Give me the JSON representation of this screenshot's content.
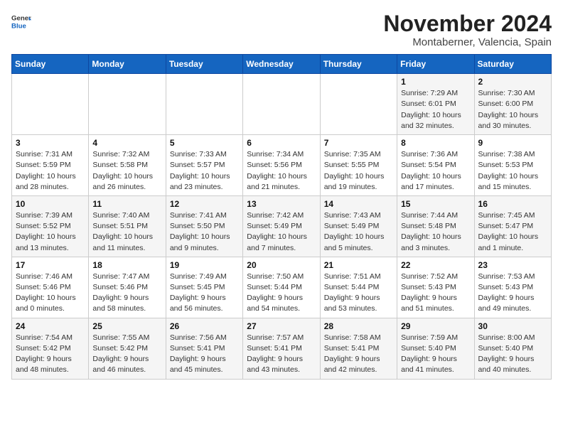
{
  "header": {
    "logo_line1": "General",
    "logo_line2": "Blue",
    "month": "November 2024",
    "location": "Montaberner, Valencia, Spain"
  },
  "weekdays": [
    "Sunday",
    "Monday",
    "Tuesday",
    "Wednesday",
    "Thursday",
    "Friday",
    "Saturday"
  ],
  "weeks": [
    [
      {
        "day": "",
        "info": ""
      },
      {
        "day": "",
        "info": ""
      },
      {
        "day": "",
        "info": ""
      },
      {
        "day": "",
        "info": ""
      },
      {
        "day": "",
        "info": ""
      },
      {
        "day": "1",
        "info": "Sunrise: 7:29 AM\nSunset: 6:01 PM\nDaylight: 10 hours and 32 minutes."
      },
      {
        "day": "2",
        "info": "Sunrise: 7:30 AM\nSunset: 6:00 PM\nDaylight: 10 hours and 30 minutes."
      }
    ],
    [
      {
        "day": "3",
        "info": "Sunrise: 7:31 AM\nSunset: 5:59 PM\nDaylight: 10 hours and 28 minutes."
      },
      {
        "day": "4",
        "info": "Sunrise: 7:32 AM\nSunset: 5:58 PM\nDaylight: 10 hours and 26 minutes."
      },
      {
        "day": "5",
        "info": "Sunrise: 7:33 AM\nSunset: 5:57 PM\nDaylight: 10 hours and 23 minutes."
      },
      {
        "day": "6",
        "info": "Sunrise: 7:34 AM\nSunset: 5:56 PM\nDaylight: 10 hours and 21 minutes."
      },
      {
        "day": "7",
        "info": "Sunrise: 7:35 AM\nSunset: 5:55 PM\nDaylight: 10 hours and 19 minutes."
      },
      {
        "day": "8",
        "info": "Sunrise: 7:36 AM\nSunset: 5:54 PM\nDaylight: 10 hours and 17 minutes."
      },
      {
        "day": "9",
        "info": "Sunrise: 7:38 AM\nSunset: 5:53 PM\nDaylight: 10 hours and 15 minutes."
      }
    ],
    [
      {
        "day": "10",
        "info": "Sunrise: 7:39 AM\nSunset: 5:52 PM\nDaylight: 10 hours and 13 minutes."
      },
      {
        "day": "11",
        "info": "Sunrise: 7:40 AM\nSunset: 5:51 PM\nDaylight: 10 hours and 11 minutes."
      },
      {
        "day": "12",
        "info": "Sunrise: 7:41 AM\nSunset: 5:50 PM\nDaylight: 10 hours and 9 minutes."
      },
      {
        "day": "13",
        "info": "Sunrise: 7:42 AM\nSunset: 5:49 PM\nDaylight: 10 hours and 7 minutes."
      },
      {
        "day": "14",
        "info": "Sunrise: 7:43 AM\nSunset: 5:49 PM\nDaylight: 10 hours and 5 minutes."
      },
      {
        "day": "15",
        "info": "Sunrise: 7:44 AM\nSunset: 5:48 PM\nDaylight: 10 hours and 3 minutes."
      },
      {
        "day": "16",
        "info": "Sunrise: 7:45 AM\nSunset: 5:47 PM\nDaylight: 10 hours and 1 minute."
      }
    ],
    [
      {
        "day": "17",
        "info": "Sunrise: 7:46 AM\nSunset: 5:46 PM\nDaylight: 10 hours and 0 minutes."
      },
      {
        "day": "18",
        "info": "Sunrise: 7:47 AM\nSunset: 5:46 PM\nDaylight: 9 hours and 58 minutes."
      },
      {
        "day": "19",
        "info": "Sunrise: 7:49 AM\nSunset: 5:45 PM\nDaylight: 9 hours and 56 minutes."
      },
      {
        "day": "20",
        "info": "Sunrise: 7:50 AM\nSunset: 5:44 PM\nDaylight: 9 hours and 54 minutes."
      },
      {
        "day": "21",
        "info": "Sunrise: 7:51 AM\nSunset: 5:44 PM\nDaylight: 9 hours and 53 minutes."
      },
      {
        "day": "22",
        "info": "Sunrise: 7:52 AM\nSunset: 5:43 PM\nDaylight: 9 hours and 51 minutes."
      },
      {
        "day": "23",
        "info": "Sunrise: 7:53 AM\nSunset: 5:43 PM\nDaylight: 9 hours and 49 minutes."
      }
    ],
    [
      {
        "day": "24",
        "info": "Sunrise: 7:54 AM\nSunset: 5:42 PM\nDaylight: 9 hours and 48 minutes."
      },
      {
        "day": "25",
        "info": "Sunrise: 7:55 AM\nSunset: 5:42 PM\nDaylight: 9 hours and 46 minutes."
      },
      {
        "day": "26",
        "info": "Sunrise: 7:56 AM\nSunset: 5:41 PM\nDaylight: 9 hours and 45 minutes."
      },
      {
        "day": "27",
        "info": "Sunrise: 7:57 AM\nSunset: 5:41 PM\nDaylight: 9 hours and 43 minutes."
      },
      {
        "day": "28",
        "info": "Sunrise: 7:58 AM\nSunset: 5:41 PM\nDaylight: 9 hours and 42 minutes."
      },
      {
        "day": "29",
        "info": "Sunrise: 7:59 AM\nSunset: 5:40 PM\nDaylight: 9 hours and 41 minutes."
      },
      {
        "day": "30",
        "info": "Sunrise: 8:00 AM\nSunset: 5:40 PM\nDaylight: 9 hours and 40 minutes."
      }
    ]
  ]
}
